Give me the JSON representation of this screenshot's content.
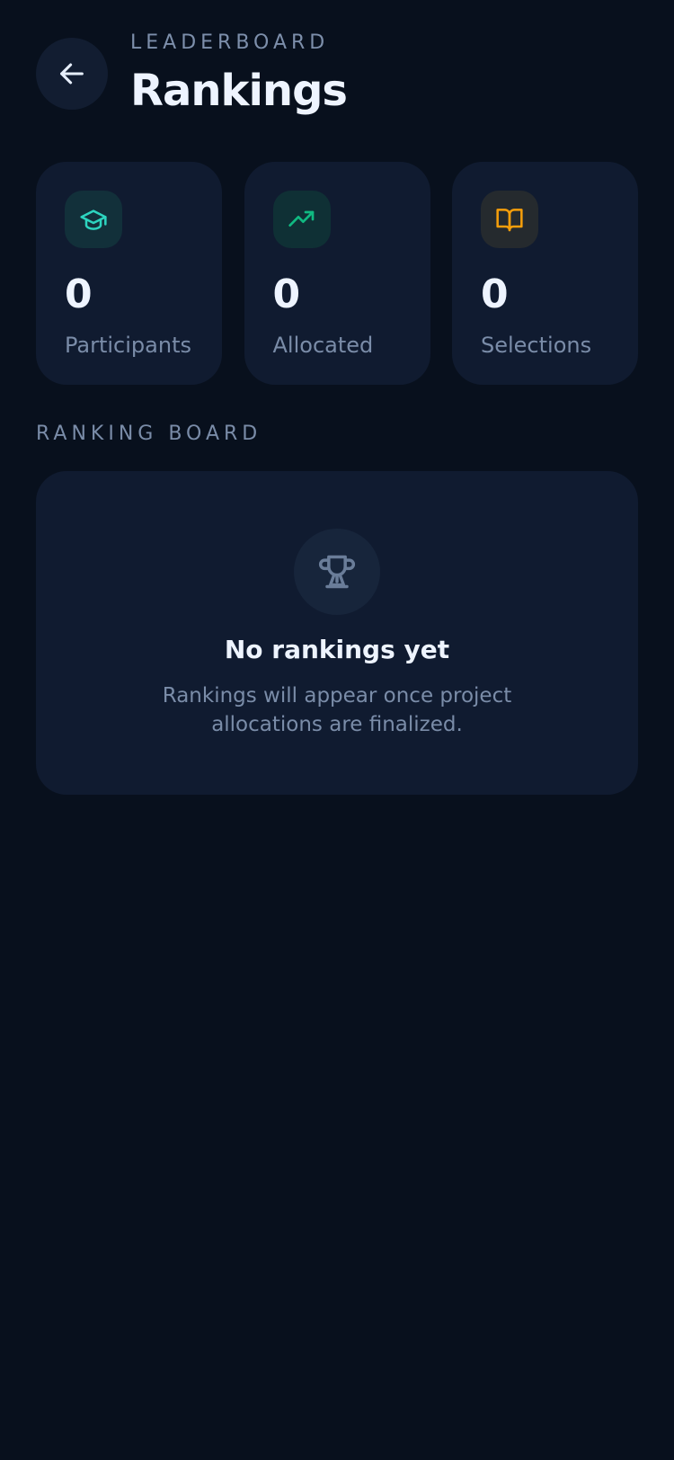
{
  "header": {
    "eyebrow": "LEADERBOARD",
    "title": "Rankings"
  },
  "stats": [
    {
      "icon": "graduation-cap-icon",
      "value": "0",
      "label": "Participants",
      "color": "#2dd4bf",
      "bg": "#12303a"
    },
    {
      "icon": "trending-up-icon",
      "value": "0",
      "label": "Allocated",
      "color": "#10b981",
      "bg": "#0f3035"
    },
    {
      "icon": "book-open-icon",
      "value": "0",
      "label": "Selections",
      "color": "#f59e0b",
      "bg": "#252a2e"
    }
  ],
  "section": {
    "label": "RANKING BOARD"
  },
  "empty_state": {
    "icon": "trophy-icon",
    "title": "No rankings yet",
    "description": "Rankings will appear once project allocations are finalized."
  },
  "colors": {
    "background": "#08101d",
    "card": "#101b30",
    "muted_text": "#7a8ca8"
  }
}
